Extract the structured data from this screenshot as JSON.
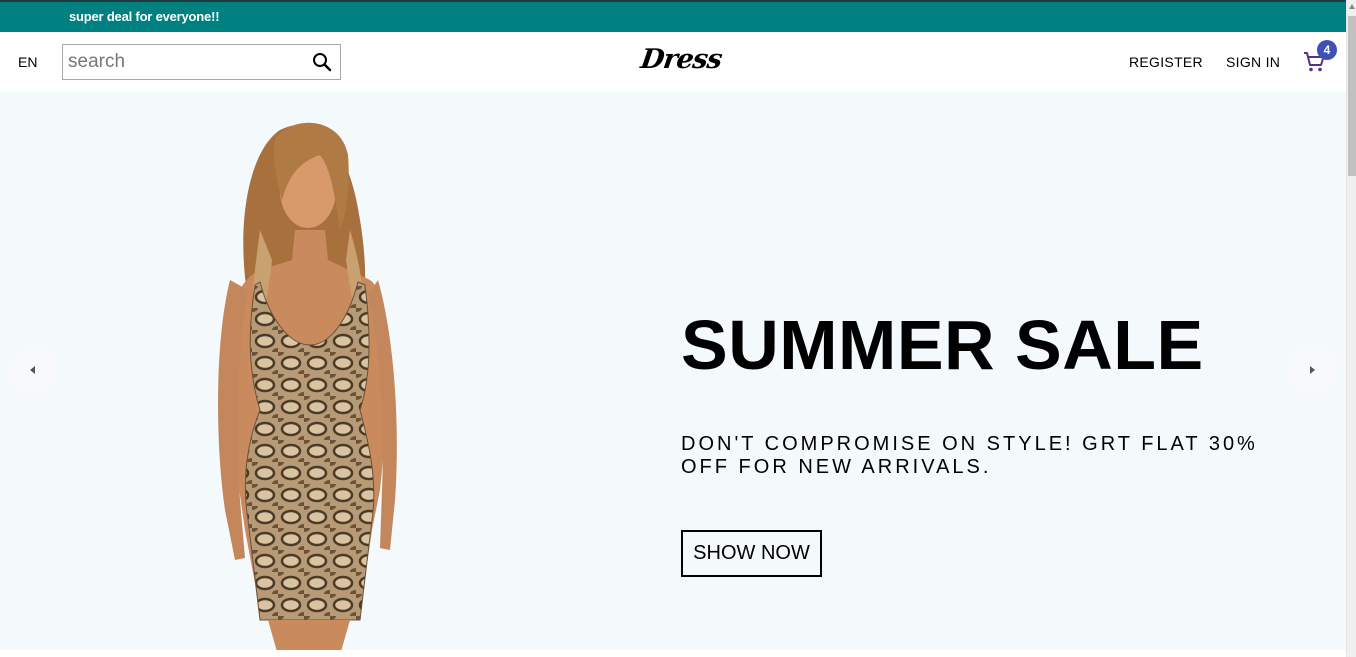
{
  "announcement": {
    "text": "super deal for everyone!!"
  },
  "navbar": {
    "language": "EN",
    "search": {
      "placeholder": "search",
      "value": ""
    },
    "logo": "Dress",
    "register": "REGISTER",
    "sign_in": "SIGN IN",
    "cart": {
      "icon": "shopping-cart-icon",
      "count": "4"
    }
  },
  "slider": {
    "title": "SUMMER SALE",
    "description": "DON'T COMPROMISE ON STYLE! GRT FLAT 30% OFF FOR NEW ARRIVALS.",
    "button_label": "SHOW NOW",
    "left_arrow_icon": "arrow-left-icon",
    "right_arrow_icon": "arrow-right-icon"
  },
  "colors": {
    "announcement_bg": "#008080",
    "slider_bg": "#f4f9fc",
    "badge_bg": "#3f51b5",
    "cart_icon": "#5b2d8e"
  }
}
